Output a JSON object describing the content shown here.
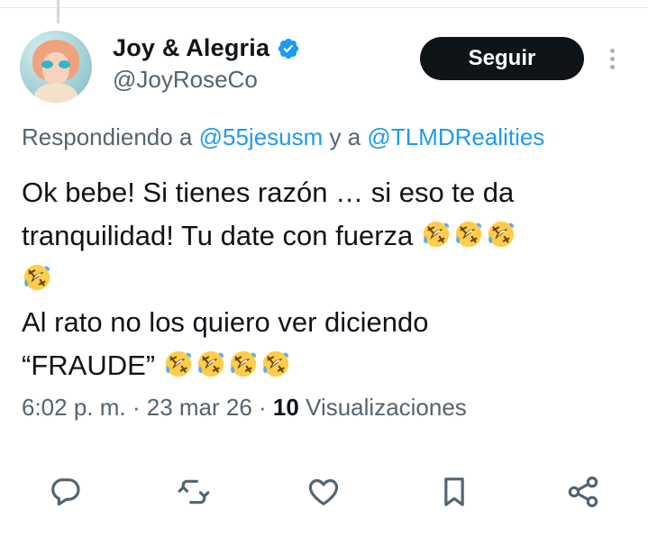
{
  "author": {
    "display_name": "Joy & Alegria",
    "handle": "@JoyRoseCo"
  },
  "follow_label": "Seguir",
  "reply_context": {
    "prefix": "Respondiendo a ",
    "mention_1": "@55jesusm",
    "joiner": " y a ",
    "mention_2": "@TLMDRealities"
  },
  "tweet": {
    "line_1": "Ok bebe! Si tienes razón … si eso te da",
    "line_2": "tranquilidad! Tu date con fuerza ",
    "line_4": "Al rato no los quiero ver diciendo",
    "line_5": "“FRAUDE” ",
    "emoji_name": "rolling-on-the-floor-laughing"
  },
  "meta": {
    "time": "6:02 p. m.",
    "separator": " · ",
    "date": "23 mar 26",
    "views_count": "10",
    "views_label": " Visualizaciones"
  },
  "colors": {
    "link": "#1d9bf0",
    "secondary_text": "#536471",
    "primary_text": "#0f1419",
    "follow_bg": "#0f1419",
    "verified": "#1d9bf0"
  },
  "action_icons": [
    "reply-icon",
    "repost-icon",
    "like-icon",
    "bookmark-icon",
    "share-icon"
  ]
}
